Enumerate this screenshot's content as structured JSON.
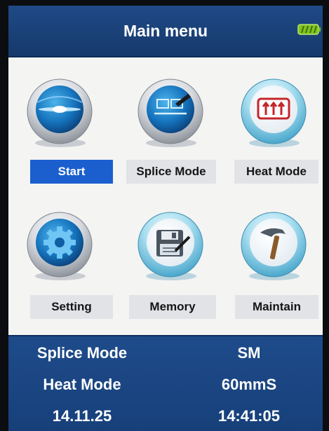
{
  "header": {
    "title": "Main menu",
    "battery_icon": "battery-full-icon"
  },
  "menu": {
    "items": [
      {
        "label": "Start",
        "icon": "fiber-splice-icon",
        "selected": true
      },
      {
        "label": "Splice Mode",
        "icon": "splice-mode-icon",
        "selected": false
      },
      {
        "label": "Heat Mode",
        "icon": "heater-icon",
        "selected": false
      },
      {
        "label": "Setting",
        "icon": "gear-icon",
        "selected": false
      },
      {
        "label": "Memory",
        "icon": "floppy-disk-icon",
        "selected": false
      },
      {
        "label": "Maintain",
        "icon": "hammer-icon",
        "selected": false
      }
    ]
  },
  "status": {
    "splice_mode_label": "Splice Mode",
    "splice_mode_value": "SM",
    "heat_mode_label": "Heat Mode",
    "heat_mode_value": "60mmS",
    "date": "14.11.25",
    "time": "14:41:05"
  },
  "colors": {
    "header_blue": "#1f4a86",
    "selected_blue": "#1b5fcf",
    "battery_green": "#7fc41d"
  }
}
